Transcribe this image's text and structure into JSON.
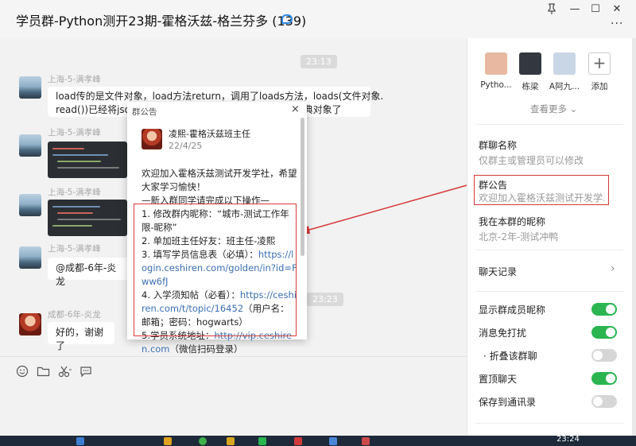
{
  "window": {
    "title": "学员群-Python测开23期-霍格沃兹-格兰芬多 (139)",
    "pin_icon": "pin-icon",
    "minimize_label": "—",
    "maximize_label": "☐",
    "close_label": "✕",
    "more_label": "···"
  },
  "chat": {
    "time_top": "23:13",
    "time_bottom": "23:23",
    "messages": [
      {
        "sender": "上海-5-满孝峰",
        "text_line1": "load传的是文件对象，load方法return，调用了loads方法，loads(文件对象.",
        "text_line2": "read())已经将json",
        "text_tail": "典对象了"
      },
      {
        "sender": "上海-5-满孝峰",
        "type": "image"
      },
      {
        "sender": "上海-5-满孝峰",
        "type": "image"
      },
      {
        "sender": "上海-5-满孝峰",
        "text": "@成都-6年-炎龙"
      },
      {
        "sender": "成都-6年-炎龙",
        "text": "好的，谢谢了"
      }
    ],
    "toolbar_icons": [
      "emoji-icon",
      "folder-icon",
      "scissors-icon",
      "chat-bubble-icon"
    ]
  },
  "notice_popup": {
    "header": "群公告",
    "close_label": "×",
    "author": "凌熙-霍格沃兹班主任",
    "date": "22/4/25",
    "intro": "欢迎加入霍格沃兹测试开发学社，希望大家学习愉快！",
    "steps_title": "—新入群同学请完成以下操作—",
    "step1": "1. 修改群内昵称：“城市-测试工作年限-昵称”",
    "step2": "2. 单加班主任好友：班主任-凌熙",
    "step3_prefix": "3. 填写学员信息表（必填）：",
    "step3_link": "https://login.ceshiren.com/golden/in?id=Fww6fJ",
    "step4_prefix": "4. 入学须知帖（必看）：",
    "step4_link": "https://ceshiren.com/t/topic/16452",
    "step4_suffix": "（用户名：邮箱；密码：hogwarts）",
    "step5_prefix": "5.学员系统地址：",
    "step5_link": "http://vip.ceshiren.com",
    "step5_suffix": "（微信扫码登录）"
  },
  "side_panel": {
    "members": [
      {
        "name": "Pytho...",
        "color": "#e8b9a0"
      },
      {
        "name": "栋梁",
        "color": "#333840"
      },
      {
        "name": "A阿九...",
        "color": "#c9d6e6"
      }
    ],
    "add_label": "添加",
    "add_symbol": "+",
    "view_more": "查看更多 ⌄",
    "group_name_title": "群聊名称",
    "group_name_value": "仅群主或管理员可以修改",
    "notice_title": "群公告",
    "notice_preview": "欢迎加入霍格沃兹测试开发学...",
    "my_nick_title": "我在本群的昵称",
    "my_nick_value": "北京-2年-测试冲鸭",
    "chat_history": "聊天记录",
    "settings": [
      {
        "label": "显示群成员昵称",
        "on": true
      },
      {
        "label": "消息免打扰",
        "on": true
      },
      {
        "label": "· 折叠该群聊",
        "on": false
      },
      {
        "label": "置顶聊天",
        "on": true
      },
      {
        "label": "保存到通讯录",
        "on": false
      }
    ]
  },
  "taskbar": {
    "clock": "23:24"
  }
}
